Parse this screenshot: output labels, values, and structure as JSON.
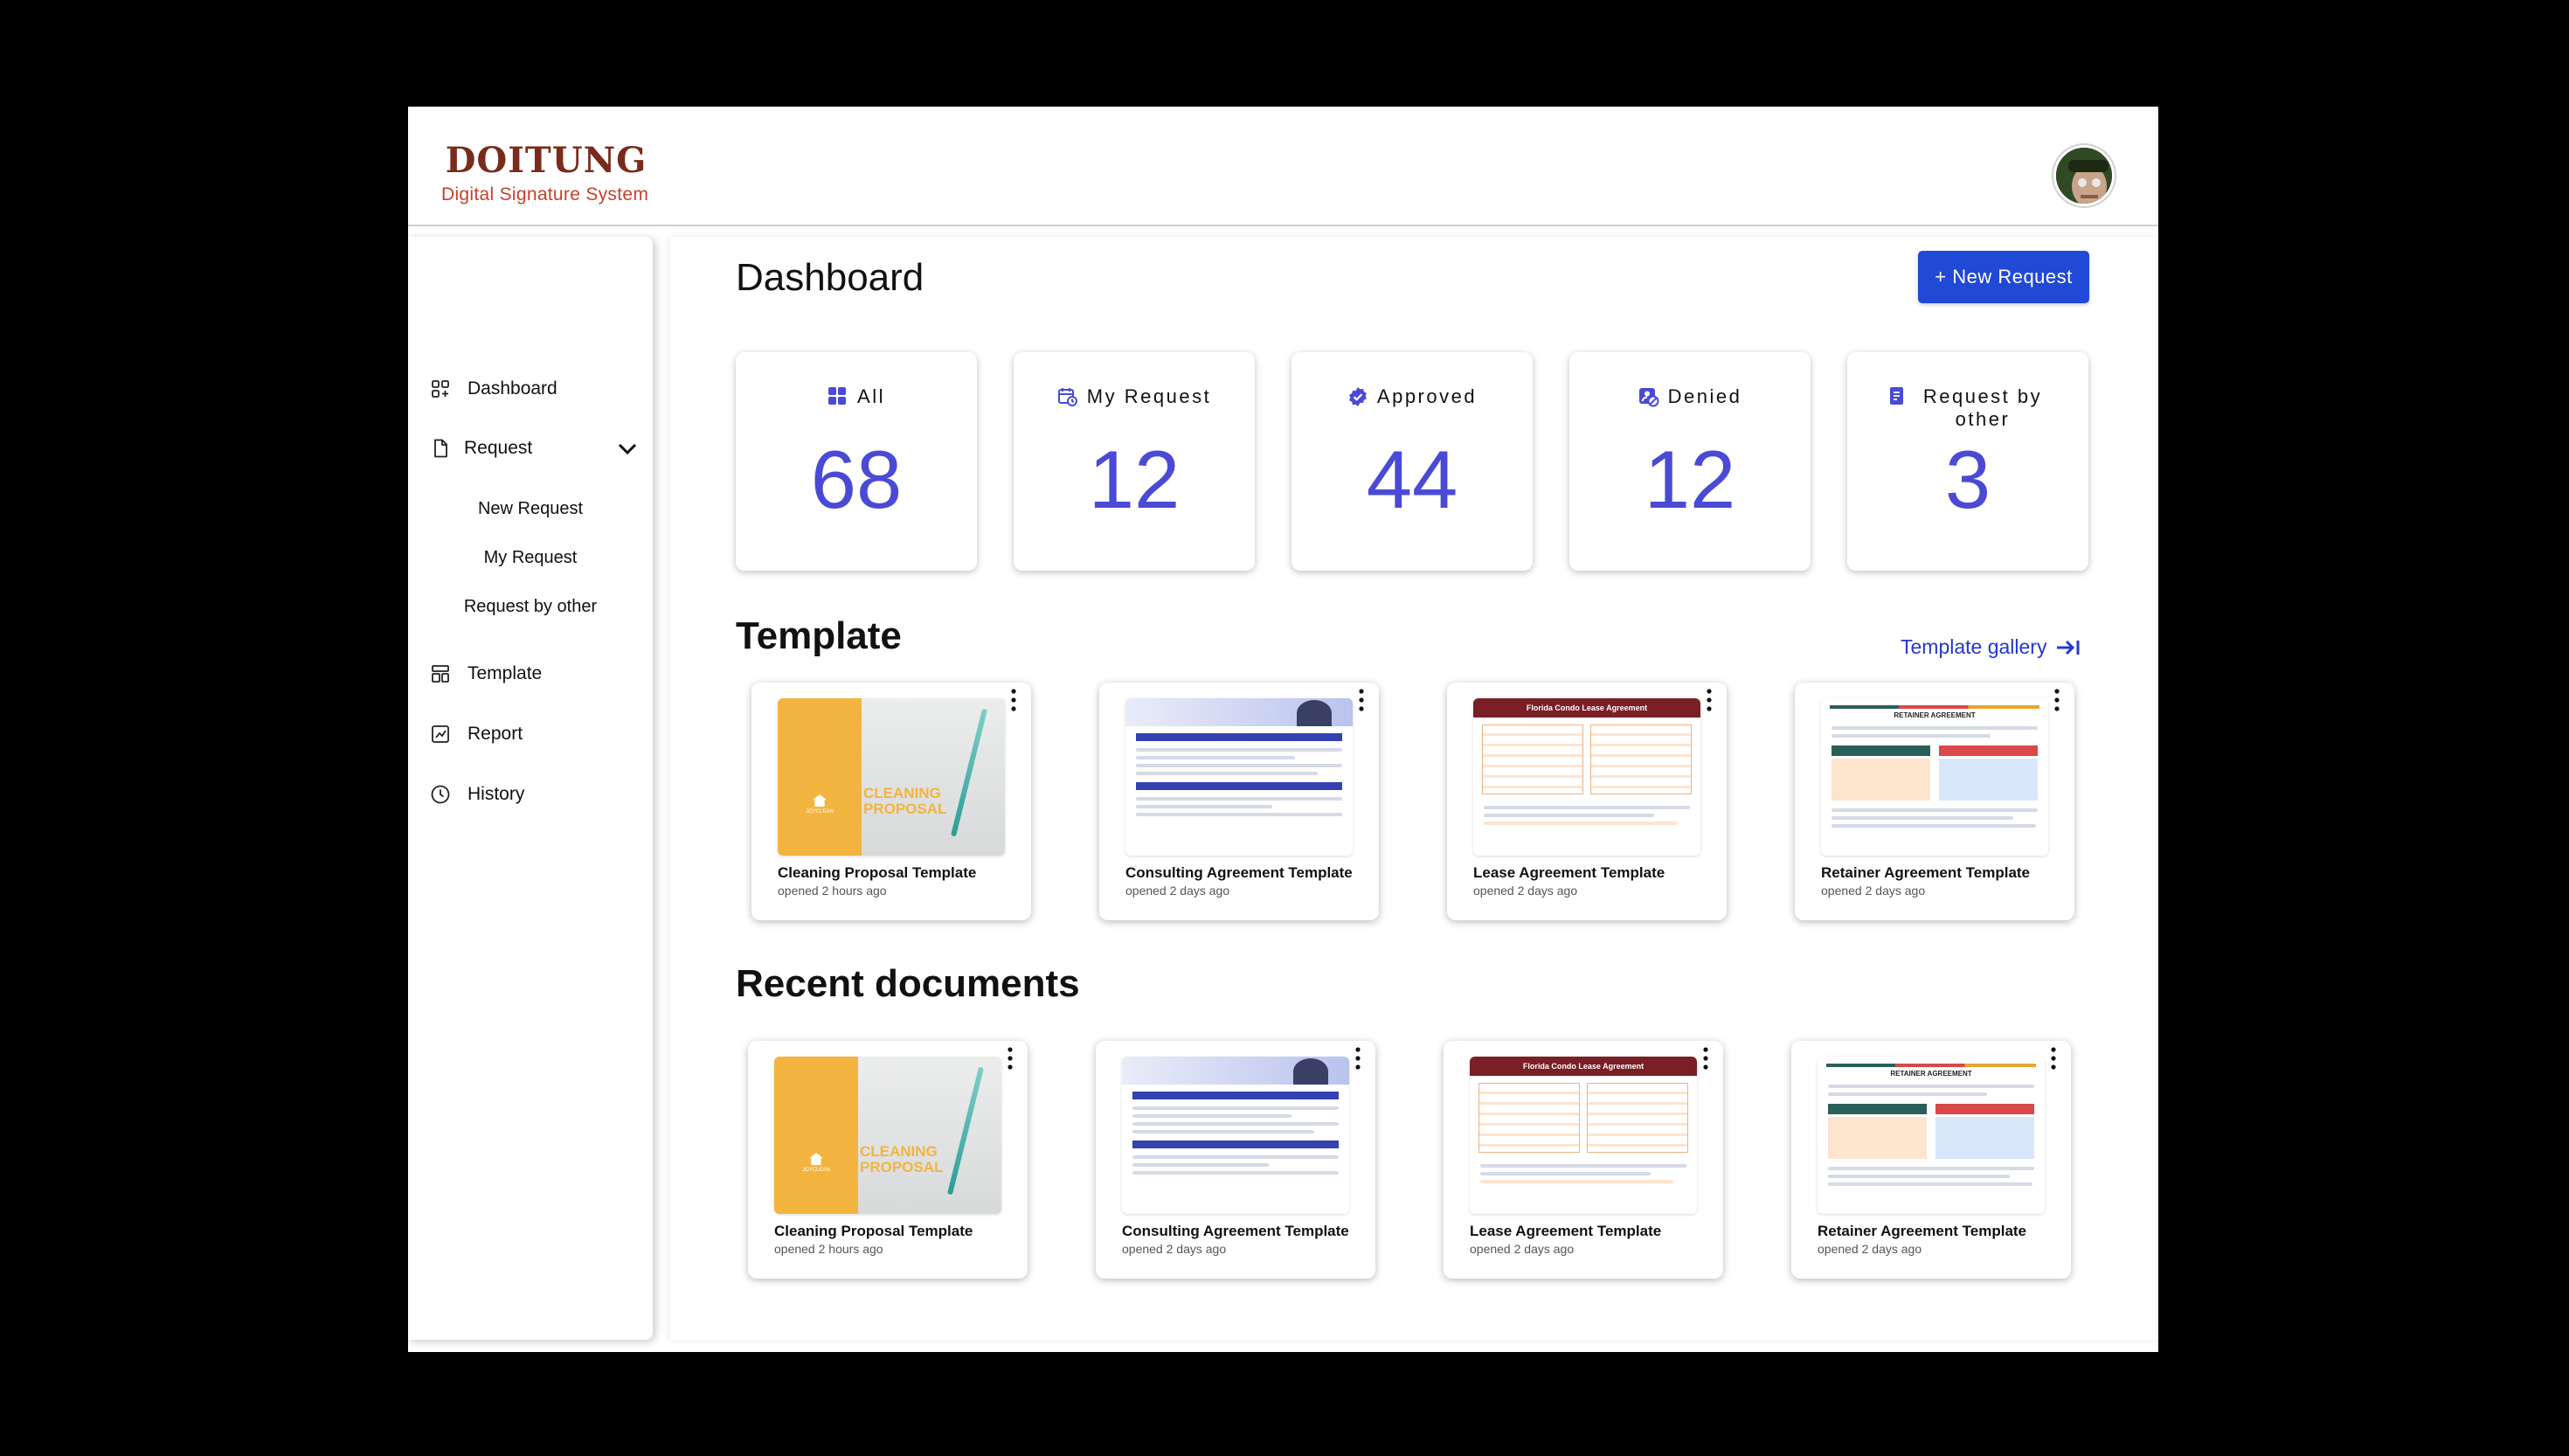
{
  "brand": {
    "logo_word": "DOITUNG",
    "subtitle": "Digital Signature System"
  },
  "sidebar": {
    "dashboard": "Dashboard",
    "request": "Request",
    "request_sub": [
      "New Request",
      "My Request",
      "Request by other"
    ],
    "template": "Template",
    "report": "Report",
    "history": "History"
  },
  "main": {
    "title": "Dashboard",
    "new_request_label": "+ New Request",
    "stats": [
      {
        "label": "All",
        "value": "68",
        "icon": "grid-icon"
      },
      {
        "label": "My Request",
        "value": "12",
        "icon": "calendar-clock-icon"
      },
      {
        "label": "Approved",
        "value": "44",
        "icon": "verified-badge-icon"
      },
      {
        "label": "Denied",
        "value": "12",
        "icon": "user-block-icon"
      },
      {
        "label": "Request by other",
        "value": "3",
        "icon": "document-icon"
      }
    ],
    "template_section": {
      "title": "Template",
      "gallery_link": "Template gallery",
      "items": [
        {
          "name": "Cleaning Proposal Template",
          "time": "opened 2 hours ago"
        },
        {
          "name": "Consulting Agreement Template",
          "time": "opened 2 days ago"
        },
        {
          "name": "Lease Agreement Template",
          "time": "opened 2 days ago"
        },
        {
          "name": "Retainer Agreement Template",
          "time": "opened 2 days ago"
        }
      ]
    },
    "recent_section": {
      "title": "Recent documents",
      "items": [
        {
          "name": "Cleaning Proposal Template",
          "time": "opened 2 hours ago"
        },
        {
          "name": "Consulting Agreement Template",
          "time": "opened 2 days ago"
        },
        {
          "name": "Lease Agreement Template",
          "time": "opened 2 days ago"
        },
        {
          "name": "Retainer Agreement Template",
          "time": "opened 2 days ago"
        }
      ]
    },
    "thumbnails": {
      "cleaning_word": "CLEANING PROPOSAL",
      "lease_heading": "Florida Condo Lease Agreement",
      "retainer_heading": "RETAINER AGREEMENT"
    }
  },
  "colors": {
    "accent": "#2049d6",
    "stat_number": "#4a4ad6",
    "link": "#2437d2",
    "brand": "#7a2b1a",
    "brand_sub": "#c8402a"
  }
}
